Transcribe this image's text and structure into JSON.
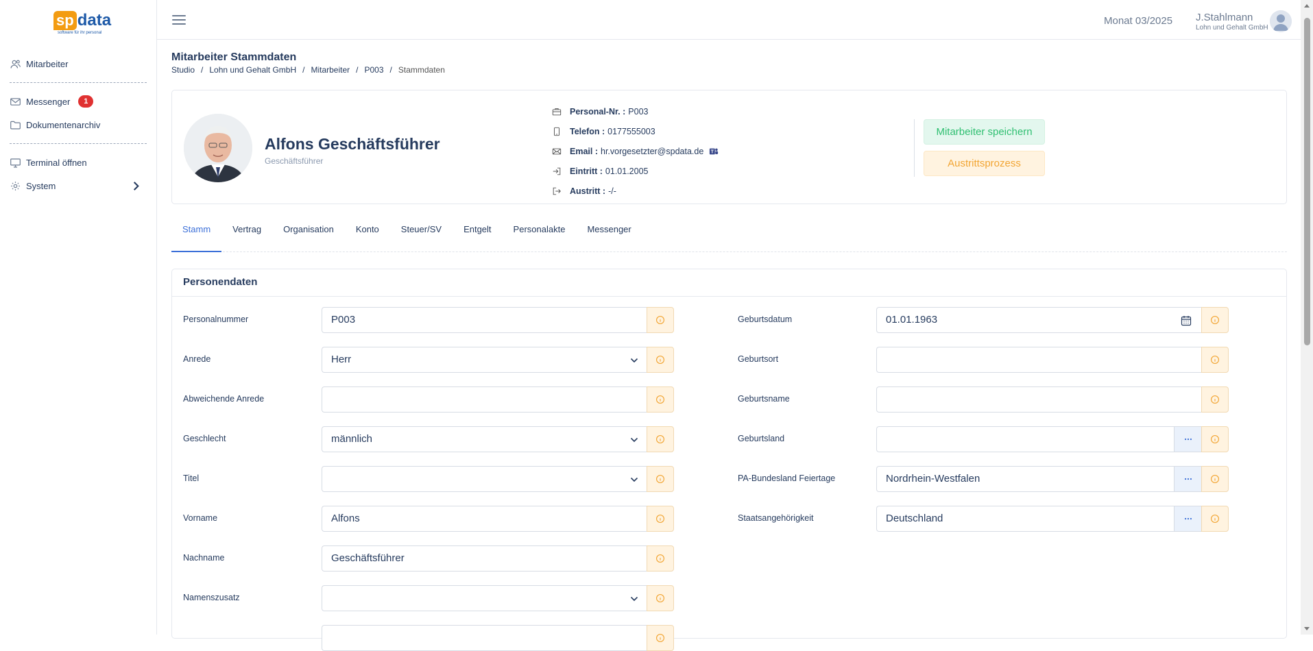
{
  "app": {
    "logo_sp": "sp",
    "logo_data": "data",
    "logo_tagline": "software für ihr personal",
    "month": "Monat 03/2025",
    "user_name": "J.Stahlmann",
    "user_company": "Lohn und Gehalt GmbH"
  },
  "sidebar": {
    "items": [
      {
        "label": "Mitarbeiter"
      },
      {
        "label": "Messenger",
        "badge": "1"
      },
      {
        "label": "Dokumentenarchiv"
      },
      {
        "label": "Terminal öffnen"
      },
      {
        "label": "System"
      }
    ]
  },
  "page": {
    "title": "Mitarbeiter Stammdaten",
    "breadcrumb": [
      "Studio",
      "Lohn und Gehalt GmbH",
      "Mitarbeiter",
      "P003",
      "Stammdaten"
    ]
  },
  "profile": {
    "name": "Alfons Geschäftsführer",
    "role": "Geschäftsführer",
    "personal_nr_label": "Personal-Nr. :",
    "personal_nr": "P003",
    "telefon_label": "Telefon :",
    "telefon": "0177555003",
    "email_label": "Email :",
    "email": "hr.vorgesetzter@spdata.de",
    "eintritt_label": "Eintritt :",
    "eintritt": "01.01.2005",
    "austritt_label": "Austritt :",
    "austritt": "-/-",
    "save_label": "Mitarbeiter speichern",
    "exit_label": "Austrittsprozess"
  },
  "tabs": [
    "Stamm",
    "Vertrag",
    "Organisation",
    "Konto",
    "Steuer/SV",
    "Entgelt",
    "Personalakte",
    "Messenger"
  ],
  "section": {
    "title": "Personendaten",
    "left_fields": [
      {
        "label": "Personalnummer",
        "value": "P003",
        "type": "text"
      },
      {
        "label": "Anrede",
        "value": "Herr",
        "type": "select"
      },
      {
        "label": "Abweichende Anrede",
        "value": "",
        "type": "text"
      },
      {
        "label": "Geschlecht",
        "value": "männlich",
        "type": "select"
      },
      {
        "label": "Titel",
        "value": "",
        "type": "select"
      },
      {
        "label": "Vorname",
        "value": "Alfons",
        "type": "text"
      },
      {
        "label": "Nachname",
        "value": "Geschäftsführer",
        "type": "text"
      },
      {
        "label": "Namenszusatz",
        "value": "",
        "type": "select"
      }
    ],
    "right_fields": [
      {
        "label": "Geburtsdatum",
        "value": "01.01.1963",
        "type": "date"
      },
      {
        "label": "Geburtsort",
        "value": "",
        "type": "text"
      },
      {
        "label": "Geburtsname",
        "value": "",
        "type": "text"
      },
      {
        "label": "Geburtsland",
        "value": "",
        "type": "lookup"
      },
      {
        "label": "PA-Bundesland Feiertage",
        "value": "Nordrhein-Westfalen",
        "type": "lookup"
      },
      {
        "label": "Staatsangehörigkeit",
        "value": "Deutschland",
        "type": "lookup"
      }
    ]
  },
  "colors": {
    "primary": "#3b6fd8",
    "save_green": "#2fbf71",
    "exit_orange": "#f2a533",
    "info_orange": "#f2a533",
    "text_dark": "#263b5e",
    "badge_red": "#e03131"
  },
  "icons": {
    "user": "user-icon",
    "mail": "mail-icon",
    "folder": "folder-icon",
    "monitor": "monitor-icon",
    "gear": "gear-icon",
    "info": "info-icon",
    "calendar": "calendar-icon",
    "chevron_down": "chevron-down-icon",
    "more": "more-icon"
  }
}
